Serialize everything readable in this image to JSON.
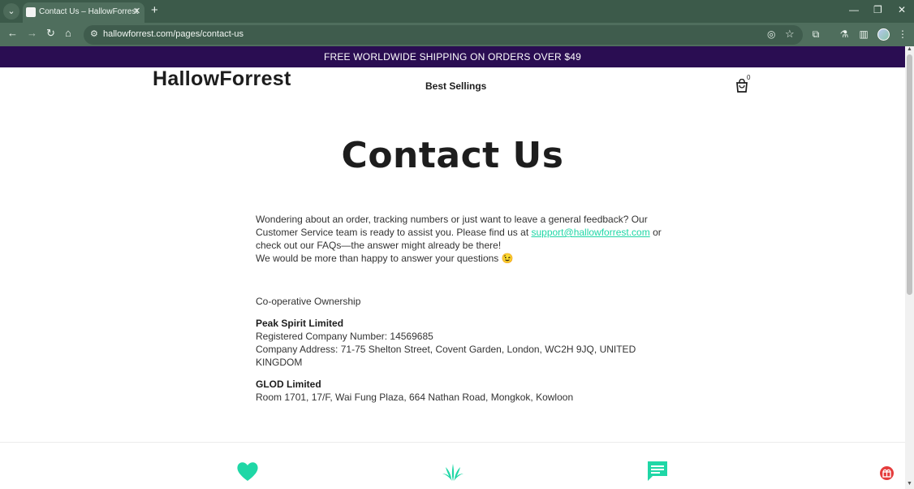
{
  "browser": {
    "tab_title": "Contact Us – HallowForrest",
    "url": "hallowforrest.com/pages/contact-us"
  },
  "promo": {
    "text": "FREE WORLDWIDE SHIPPING ON ORDERS OVER $49"
  },
  "header": {
    "logo": "HallowForrest",
    "nav": [
      "Best Sellings"
    ],
    "cart_count": "0"
  },
  "page": {
    "title": "Contact Us",
    "intro_before_link": "Wondering about an order, tracking numbers or just want to leave a general feedback? Our Customer Service team is ready to assist you. Please find us at ",
    "support_email": "support@hallowforrest.com",
    "intro_after_link": " or check out our FAQs—the answer might already be there!",
    "intro_line2": "We would be more than happy to answer your questions 😉",
    "ownership_heading": "Co-operative Ownership",
    "companies": [
      {
        "name": "Peak Spirit Limited",
        "lines": [
          "Registered Company Number: 14569685",
          "Company Address: 71-75 Shelton Street, Covent Garden, London, WC2H 9JQ, UNITED KINGDOM"
        ]
      },
      {
        "name": "GLOD Limited",
        "lines": [
          "Room 1701, 17/F, Wai Fung Plaza, 664 Nathan Road, Mongkok, Kowloon"
        ]
      }
    ]
  },
  "colors": {
    "accent": "#1fd7a6",
    "promo_bg": "#2a0d52",
    "chrome": "#4f6e5d"
  },
  "icons": [
    "heart-icon",
    "plant-icon",
    "chat-icon",
    "gift-icon"
  ]
}
